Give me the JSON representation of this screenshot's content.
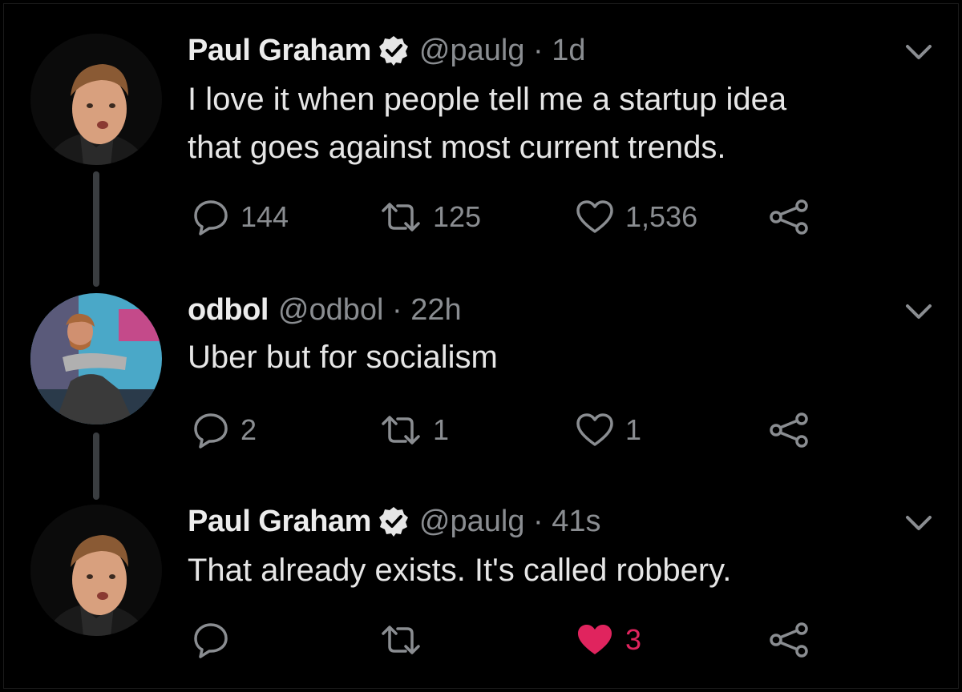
{
  "colors": {
    "background": "#000000",
    "text_primary": "#e6e6e6",
    "text_secondary": "#8a8d91",
    "like_active": "#e0245e",
    "thread_line": "#3a3d40"
  },
  "tweets": [
    {
      "name": "Paul Graham",
      "verified": true,
      "handle": "@paulg · 1d",
      "text_lines": [
        "I love it when people tell me a startup idea",
        "that goes against most current trends."
      ],
      "reply_count": "144",
      "retweet_count": "125",
      "like_count": "1,536",
      "liked": false
    },
    {
      "name": "odbol",
      "verified": false,
      "handle": "@odbol · 22h",
      "text_lines": [
        "Uber but for socialism"
      ],
      "reply_count": "2",
      "retweet_count": "1",
      "like_count": "1",
      "liked": false
    },
    {
      "name": "Paul Graham",
      "verified": true,
      "handle": "@paulg · 41s",
      "text_lines": [
        "That already exists. It's called robbery."
      ],
      "reply_count": "",
      "retweet_count": "",
      "like_count": "3",
      "liked": true
    }
  ],
  "icons": {
    "reply": "reply-icon",
    "retweet": "retweet-icon",
    "like": "heart-icon",
    "share": "share-icon",
    "caret": "chevron-down-icon",
    "verified": "verified-badge-icon"
  }
}
